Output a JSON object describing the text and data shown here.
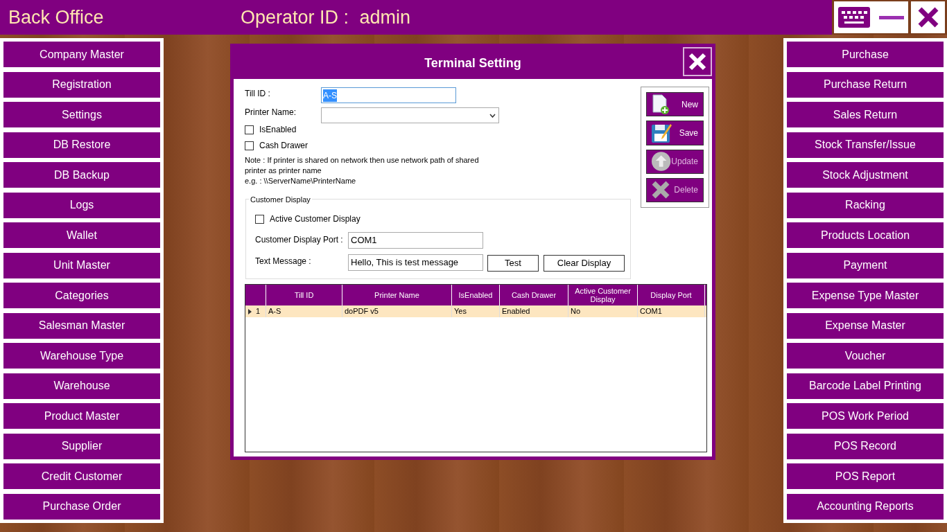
{
  "header": {
    "title": "Back Office",
    "operator_label": "Operator ID :",
    "operator": "admin"
  },
  "left_menu": [
    "Company Master",
    "Registration",
    "Settings",
    "DB Restore",
    "DB Backup",
    "Logs",
    "Wallet",
    "Unit Master",
    "Categories",
    "Salesman Master",
    "Warehouse Type",
    "Warehouse",
    "Product Master",
    "Supplier",
    "Credit Customer",
    "Purchase Order"
  ],
  "right_menu": [
    "Purchase",
    "Purchase Return",
    "Sales Return",
    "Stock Transfer/Issue",
    "Stock Adjustment",
    "Racking",
    "Products Location",
    "Payment",
    "Expense Type Master",
    "Expense Master",
    "Voucher",
    "Barcode Label Printing",
    "POS Work Period",
    "POS Record",
    "POS Report",
    "Accounting Reports"
  ],
  "dialog": {
    "title": "Terminal Setting",
    "till_id": {
      "label": "Till ID :",
      "value": "A-S",
      "highlighted": true
    },
    "printer_name": {
      "label": "Printer Name:"
    },
    "checkboxes": [
      {
        "label": "IsEnabled",
        "checked": false
      },
      {
        "label": "Cash Drawer",
        "checked": false
      }
    ],
    "note": [
      "Note : If printer is shared on network then use network path of shared",
      "printer as printer name",
      "e.g. : \\\\ServerName\\PrinterName"
    ],
    "customer_display": {
      "legend": "Customer Display",
      "active": {
        "label": "Active Customer Display",
        "checked": false
      },
      "port_label": "Customer Display Port :",
      "port": "COM1",
      "message_label": "Text Message :",
      "message": "Hello, This is test message",
      "buttons": [
        "Test",
        "Clear Display"
      ]
    },
    "actions": [
      {
        "label": "New",
        "kind": "new",
        "disabled": false
      },
      {
        "label": "Save",
        "kind": "save",
        "disabled": false
      },
      {
        "label": "Update",
        "kind": "update",
        "disabled": true
      },
      {
        "label": "Delete",
        "kind": "delete",
        "disabled": true
      }
    ],
    "table": {
      "columns": [
        "Till ID",
        "Printer Name",
        "IsEnabled",
        "Cash Drawer",
        "Active Customer Display",
        "Display Port"
      ],
      "rows": [
        {
          "number": "1",
          "selected": true,
          "cells": [
            "A-S",
            "doPDF v5",
            "Yes",
            "Enabled",
            "No",
            "COM1"
          ]
        }
      ]
    }
  }
}
